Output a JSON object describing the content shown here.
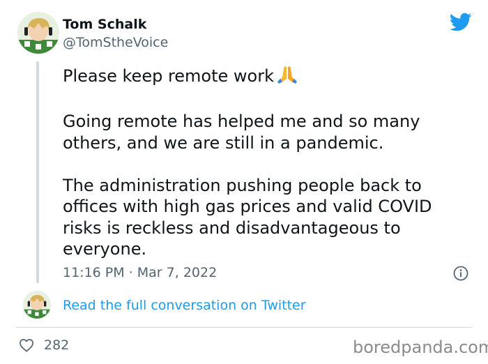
{
  "author": {
    "name": "Tom Schalk",
    "handle": "@TomStheVoice"
  },
  "tweet": {
    "line1": "Please keep remote work",
    "paragraph2": "Going remote has helped me and so many others, and we are still in a pandemic.",
    "paragraph3": "The administration pushing people back to offices with high gas prices and valid COVID risks is reckless and disadvantageous to everyone.",
    "emoji": "folded-hands"
  },
  "meta": {
    "timestamp": "11:16 PM · Mar 7, 2022"
  },
  "footer": {
    "read_link": "Read the full conversation on Twitter",
    "like_count": "282",
    "watermark": "boredpanda.com"
  },
  "icons": {
    "brand": "twitter-bird-icon",
    "info": "info-icon",
    "like": "heart-icon"
  },
  "colors": {
    "twitter_blue": "#1d9bf0",
    "secondary_text": "#536471",
    "primary_text": "#0f1419",
    "divider": "#cfd9de"
  }
}
